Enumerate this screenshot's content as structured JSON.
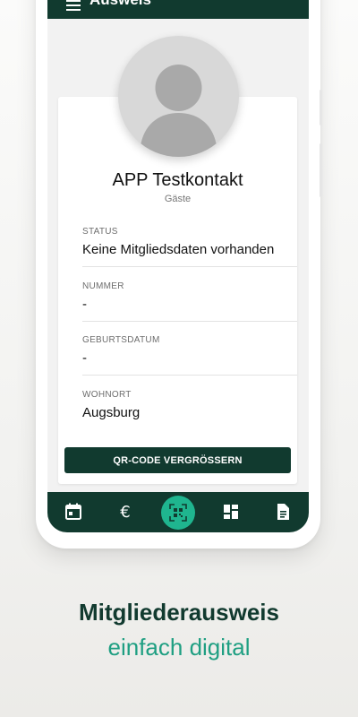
{
  "appbar": {
    "title": "Ausweis"
  },
  "profile": {
    "name": "APP Testkontakt",
    "group": "Gäste"
  },
  "fields": [
    {
      "label": "STATUS",
      "value": "Keine Mitgliedsdaten vorhanden"
    },
    {
      "label": "NUMMER",
      "value": "-"
    },
    {
      "label": "GEBURTSDATUM",
      "value": "-"
    },
    {
      "label": "WOHNORT",
      "value": "Augsburg"
    }
  ],
  "qr_button": {
    "label": "QR-CODE VERGRÖSSERN"
  },
  "bottom_nav": {
    "items": [
      {
        "icon": "calendar-icon"
      },
      {
        "icon": "euro-icon"
      },
      {
        "icon": "qr-code-icon",
        "active": true
      },
      {
        "icon": "dashboard-icon"
      },
      {
        "icon": "document-icon"
      }
    ]
  },
  "marketing": {
    "headline": "Mitgliederausweis",
    "subline": "einfach digital"
  },
  "colors": {
    "primary": "#113a2f",
    "accent": "#1fb58f",
    "accent_text": "#1f9f82"
  }
}
